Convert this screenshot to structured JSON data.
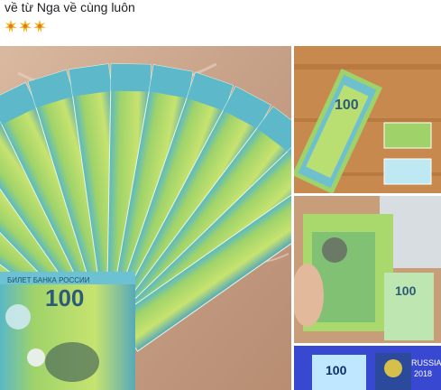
{
  "post": {
    "caption_line1": "về từ Nga về cùng luôn",
    "emoji_icons": [
      "collision-icon",
      "collision-icon",
      "collision-icon"
    ]
  },
  "photos": {
    "main": {
      "alt_icon": "photo-banknote-fan",
      "banknote_text_1": "БИЛЕТ БАНКА РОССИИ",
      "banknote_text_2": "100"
    },
    "side1": {
      "alt_icon": "photo-banknotes-on-table",
      "banknote_text": "100"
    },
    "side2": {
      "alt_icon": "photo-banknote-in-hand",
      "banknote_text": "100"
    },
    "side3": {
      "alt_icon": "photo-banknote-uv",
      "banknote_text": "100",
      "logo_text_1": "RUSSIA",
      "logo_text_2": "2018"
    }
  },
  "colors": {
    "text": "#1c1e21",
    "note_green": "#8cc63f",
    "note_teal": "#4fb6c8",
    "table": "#c9a98a",
    "wood": "#c8894f"
  }
}
